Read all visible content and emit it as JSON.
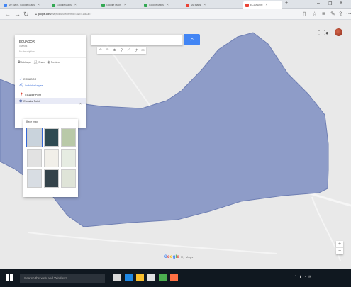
{
  "browser": {
    "tabs": [
      {
        "label": "My Maps, Google Maps",
        "active": false,
        "favicon_color": "#4285f4"
      },
      {
        "label": "Google Maps",
        "active": false,
        "favicon_color": "#34a853"
      },
      {
        "label": "Google Maps",
        "active": false,
        "favicon_color": "#34a853"
      },
      {
        "label": "Google Maps",
        "active": false,
        "favicon_color": "#34a853"
      },
      {
        "label": "My Maps",
        "active": false,
        "favicon_color": "#ea4335"
      },
      {
        "label": "ECUADOR",
        "active": true,
        "favicon_color": "#ea4335"
      }
    ],
    "url_host": "google.com",
    "url_path": "/maps/d/u/0/edit?mid=1&ll=-1.8&z=7"
  },
  "map": {
    "polygon_color": "#8e9cc8",
    "polygon_stroke": "#6f7fb3"
  },
  "panel": {
    "title": "ECUADOR",
    "subtitle": "0 views",
    "description": "No description",
    "actions": [
      {
        "icon": "add-layer-icon",
        "label": "Add layer"
      },
      {
        "icon": "share-icon",
        "label": "Share"
      },
      {
        "icon": "preview-icon",
        "label": "Preview"
      }
    ],
    "layer": {
      "name": "ECUADOR",
      "style_link": "Individual styles",
      "items": [
        "Ecuador Point",
        "Ecuador Point"
      ]
    }
  },
  "basemap": {
    "title": "Base map",
    "thumbs": [
      {
        "color": "#c9d3dc"
      },
      {
        "color": "#2e4a52"
      },
      {
        "color": "#b9c9a8"
      },
      {
        "color": "#e2e2e2"
      },
      {
        "color": "#f1efe9"
      },
      {
        "color": "#e6ece2"
      },
      {
        "color": "#d8dde3"
      },
      {
        "color": "#34434a"
      },
      {
        "color": "#dfe4d8"
      }
    ]
  },
  "footer": {
    "logo_suffix": "My Maps"
  },
  "taskbar": {
    "search_placeholder": "Search the web and Windows",
    "apps": [
      "#d9d9d9",
      "#1e88e5",
      "#fbc02d",
      "#e0e0e0",
      "#4caf50",
      "#ff7043"
    ]
  }
}
